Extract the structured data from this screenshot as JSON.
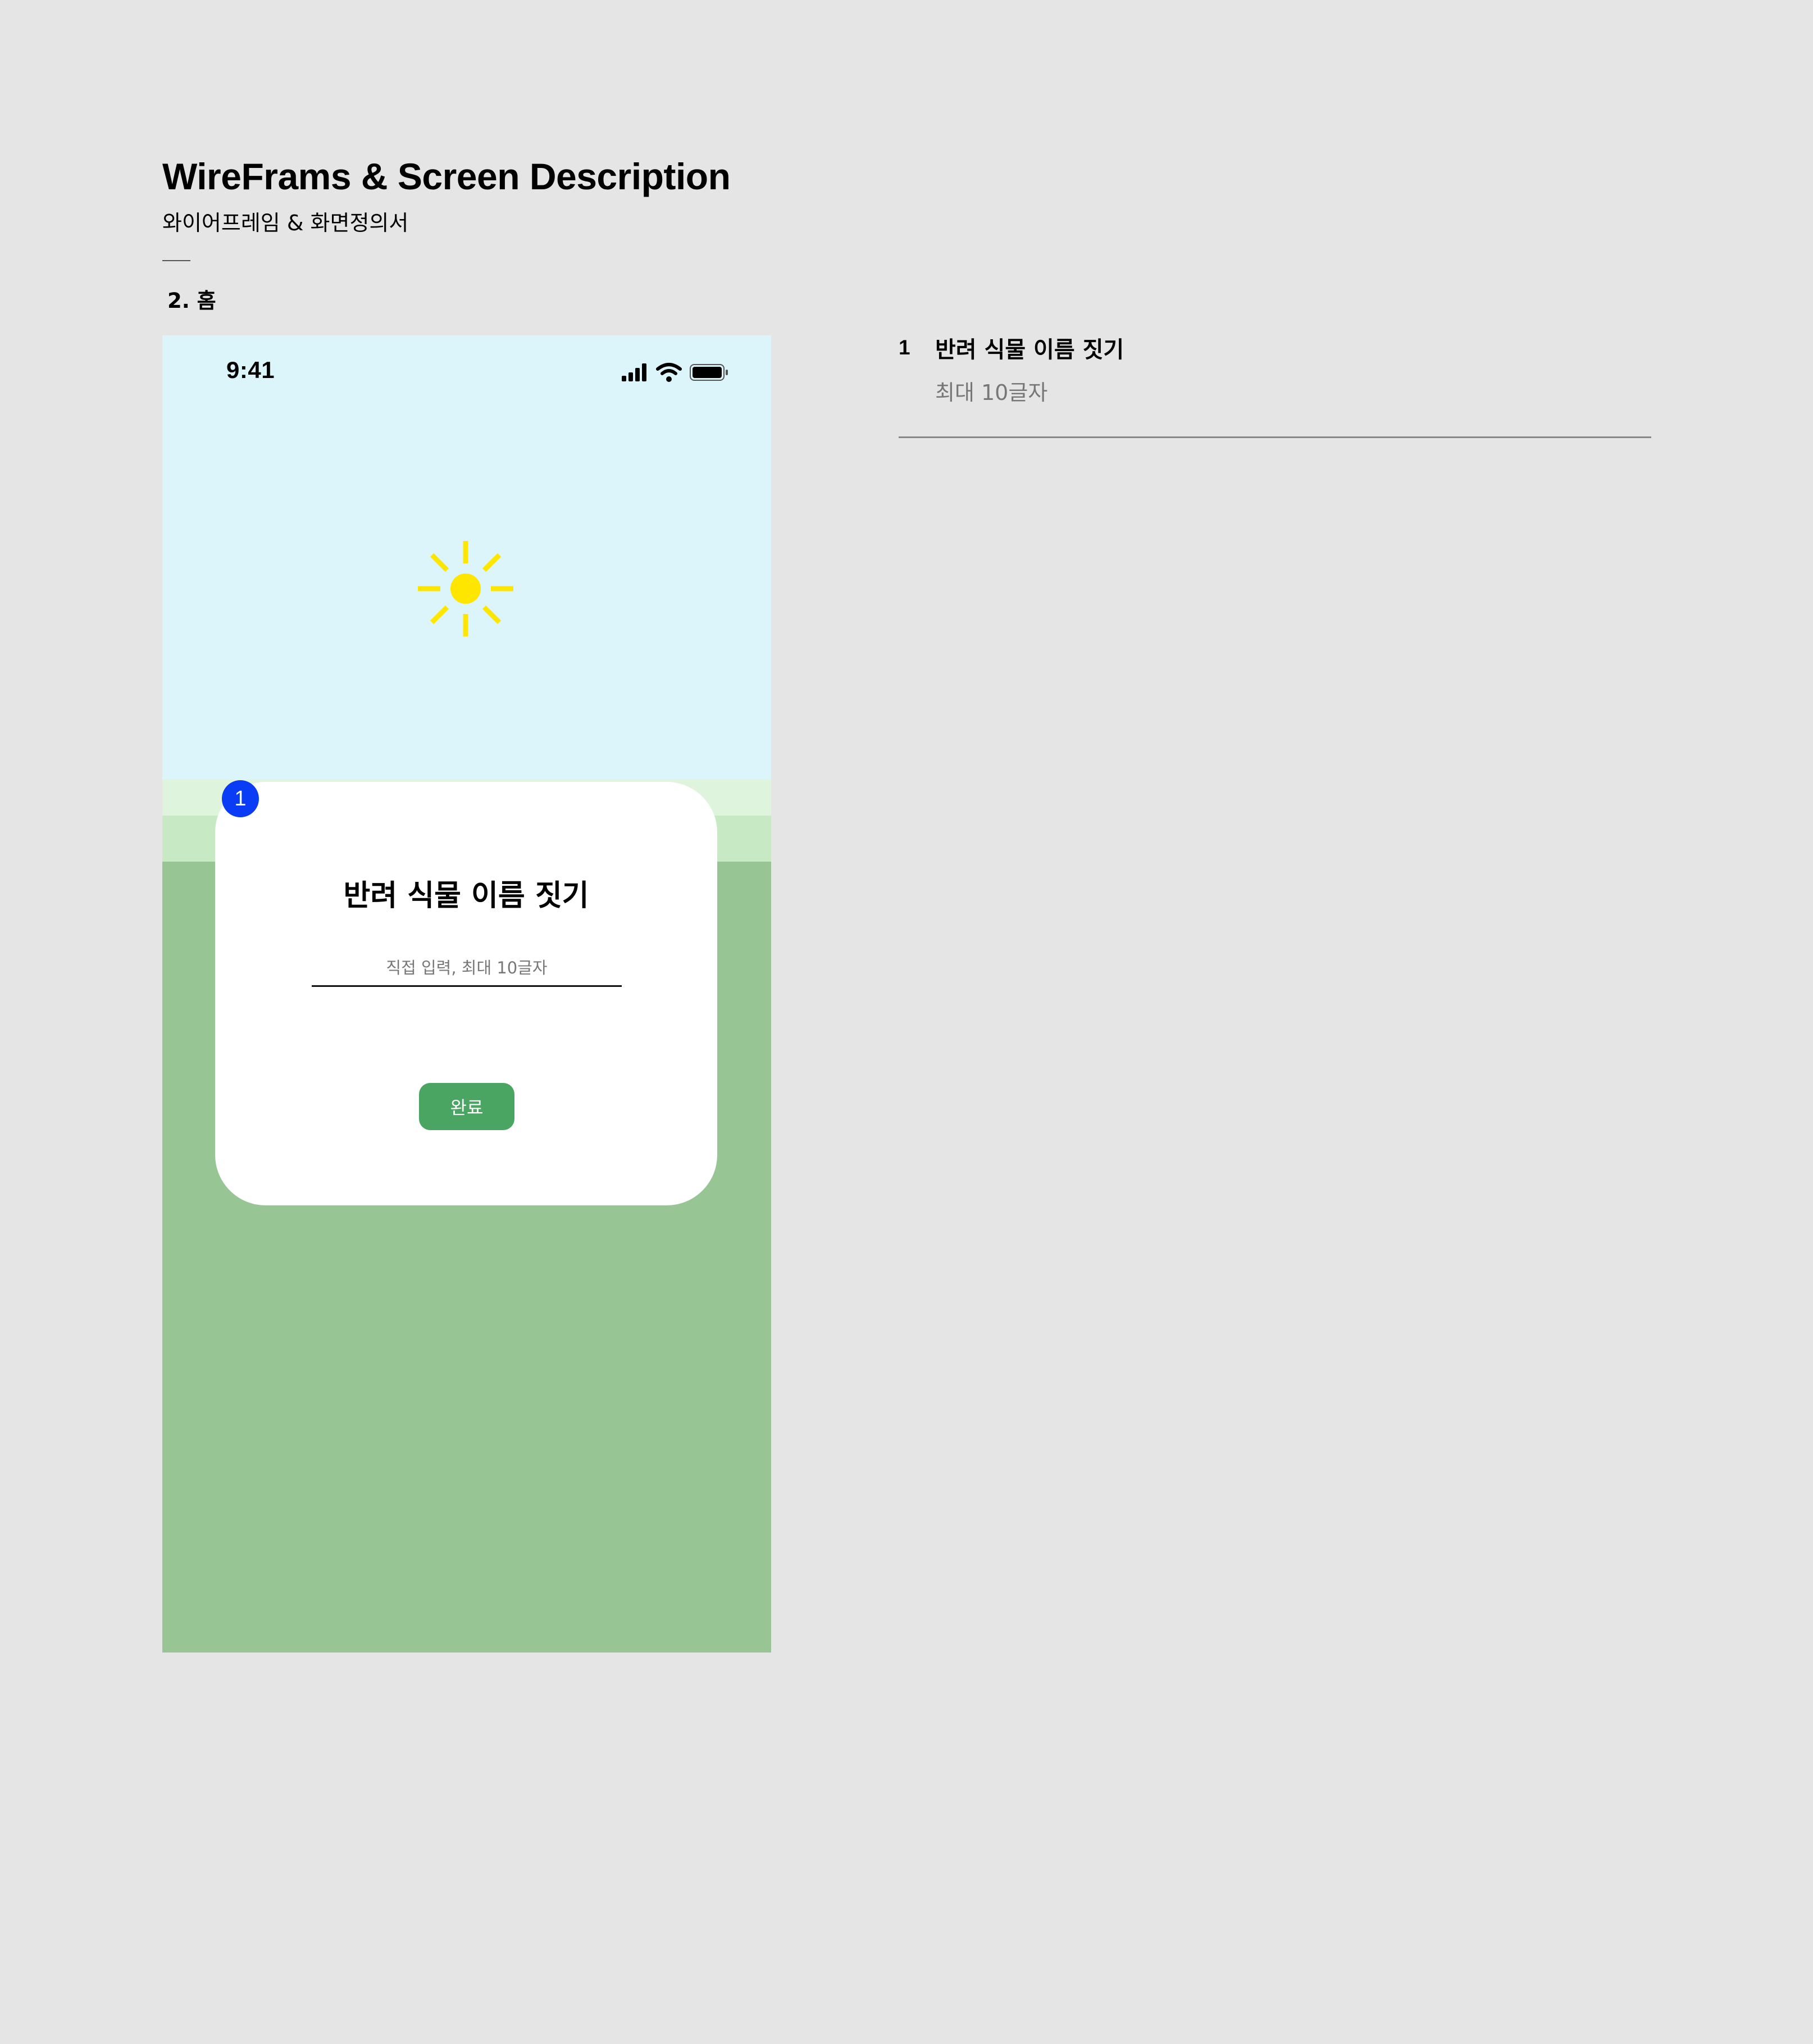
{
  "header": {
    "title": "WireFrams & Screen Description",
    "subtitle": "와이어프레임 & 화면정의서",
    "section": "2. 홈"
  },
  "phone": {
    "status_bar": {
      "time": "9:41",
      "icons": [
        "cellular-signal-icon",
        "wifi-icon",
        "battery-icon"
      ]
    },
    "hero_icon": "sun-icon",
    "modal": {
      "title": "반려 식물 이름 짓기",
      "input_value": "",
      "input_placeholder": "직접 입력, 최대 10글자",
      "done_label": "완료"
    },
    "marker": "1"
  },
  "description": {
    "items": [
      {
        "number": "1",
        "title": "반려 식물 이름 짓기",
        "detail": "최대 10글자"
      }
    ]
  },
  "colors": {
    "background": "#e5e5e5",
    "sky": "#dcf5fa",
    "ground": "#97c594",
    "band_light": "#def4dc",
    "band_mid": "#c7e9c4",
    "sun": "#ffe600",
    "button": "#4aa563",
    "marker": "#0a3cf5"
  }
}
